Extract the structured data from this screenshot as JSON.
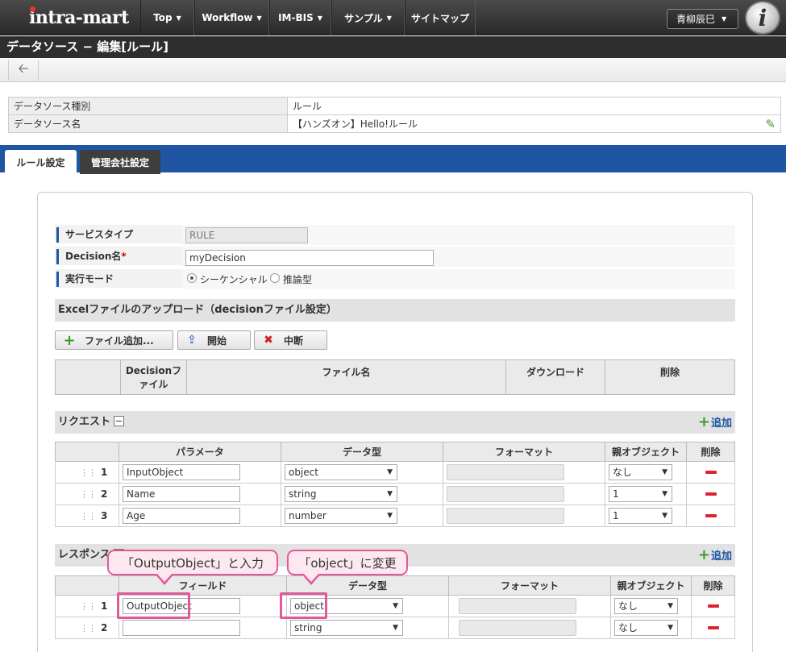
{
  "nav": {
    "logo": "intra-mart",
    "items": [
      "Top",
      "Workflow",
      "IM-BIS",
      "サンプル",
      "サイトマップ"
    ],
    "user": "青柳辰巳"
  },
  "page_title": "データソース − 編集[ルール]",
  "info": {
    "type_label": "データソース種別",
    "type_value": "ルール",
    "name_label": "データソース名",
    "name_value": "【ハンズオン】Hello!ルール"
  },
  "tabs": [
    "ルール設定",
    "管理会社設定"
  ],
  "form": {
    "service_type_label": "サービスタイプ",
    "service_type_value": "RULE",
    "decision_label": "Decision名",
    "decision_required": "*",
    "decision_value": "myDecision",
    "exec_mode_label": "実行モード",
    "exec_options": [
      "シーケンシャル",
      "推論型"
    ]
  },
  "upload": {
    "title": "Excelファイルのアップロード（decisionファイル設定）",
    "buttons": [
      "ファイル追加...",
      "開始",
      "中断"
    ],
    "columns": [
      "Decisionファイル",
      "ファイル名",
      "ダウンロード",
      "削除"
    ]
  },
  "request": {
    "title": "リクエスト",
    "add": "追加",
    "columns": [
      "パラメータ",
      "データ型",
      "フォーマット",
      "親オブジェクト",
      "削除"
    ],
    "rows": [
      {
        "num": "1",
        "param": "InputObject",
        "type": "object",
        "parent": "なし"
      },
      {
        "num": "2",
        "param": "Name",
        "type": "string",
        "parent": "1"
      },
      {
        "num": "3",
        "param": "Age",
        "type": "number",
        "parent": "1"
      }
    ]
  },
  "response": {
    "title": "レスポンス",
    "add": "追加",
    "columns": [
      "フィールド",
      "データ型",
      "フォーマット",
      "親オブジェクト",
      "削除"
    ],
    "rows": [
      {
        "num": "1",
        "field": "OutputObject",
        "type": "object",
        "parent": "なし"
      },
      {
        "num": "2",
        "field": "",
        "type": "string",
        "parent": "なし"
      }
    ]
  },
  "callouts": {
    "field": "「OutputObject」と入力",
    "type": "「object」に変更"
  },
  "colors": {
    "accent": "#1f55a3",
    "callout": "#e05a9a"
  }
}
